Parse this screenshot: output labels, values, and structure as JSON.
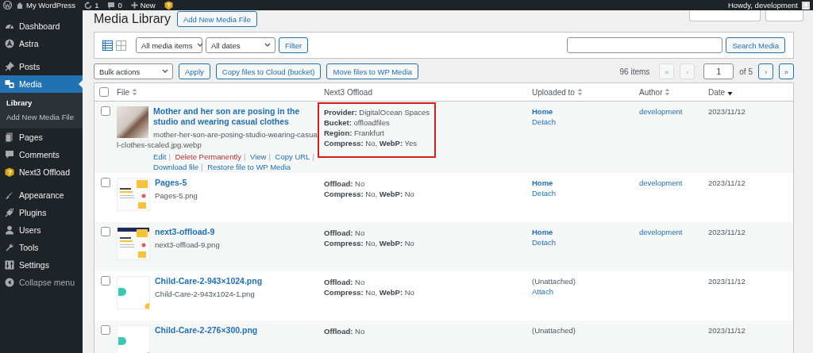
{
  "admin_bar": {
    "site": "My WordPress",
    "updates": "1",
    "comments": "0",
    "new": "New",
    "greeting": "Howdy, development"
  },
  "sidebar": {
    "groups": [
      {
        "items": [
          {
            "label": "Dashboard",
            "selected": false
          },
          {
            "label": "Astra",
            "selected": false
          }
        ]
      },
      {
        "items": [
          {
            "label": "Posts",
            "selected": false
          },
          {
            "label": "Media",
            "selected": true,
            "children": [
              {
                "label": "Library",
                "selected": true
              },
              {
                "label": "Add New Media File",
                "selected": false
              }
            ]
          },
          {
            "label": "Pages",
            "selected": false
          },
          {
            "label": "Comments",
            "selected": false
          },
          {
            "label": "Next3 Offload",
            "selected": false
          }
        ]
      },
      {
        "items": [
          {
            "label": "Appearance",
            "selected": false
          },
          {
            "label": "Plugins",
            "selected": false
          },
          {
            "label": "Users",
            "selected": false
          },
          {
            "label": "Tools",
            "selected": false
          },
          {
            "label": "Settings",
            "selected": false
          },
          {
            "label": "Collapse menu",
            "selected": false
          }
        ]
      }
    ]
  },
  "page": {
    "title": "Media Library",
    "add_button": "Add New Media File"
  },
  "filter_bar": {
    "view_modes": [
      {
        "selected": true
      },
      {
        "selected": false
      }
    ],
    "media_type": "All media items",
    "dates": "All dates",
    "filter_button": "Filter",
    "search_button": "Search Media"
  },
  "tablenav": {
    "bulk_actions": "Bulk actions",
    "apply": "Apply",
    "buttons": [
      "Copy files to Cloud (bucket)",
      "Move files to WP Media"
    ],
    "count": "96 items",
    "pagination": {
      "first": {
        "label": "«",
        "disabled": true
      },
      "prev": {
        "label": "‹",
        "disabled": true
      },
      "current": "1",
      "total": "of 5",
      "next": {
        "label": "›",
        "disabled": false
      },
      "last": {
        "label": "»",
        "disabled": false
      }
    }
  },
  "table": {
    "select_all": {
      "checked": false
    },
    "columns": [
      {
        "label": "File",
        "sortable": true,
        "sorted": false
      },
      {
        "label": "Next3 Offload",
        "sortable": false
      },
      {
        "label": "Uploaded to",
        "sortable": true,
        "sorted": false
      },
      {
        "label": "Author",
        "sortable": true,
        "sorted": false
      },
      {
        "label": "Date",
        "sortable": true,
        "sorted": true
      }
    ],
    "rows": [
      {
        "checked": false,
        "thumbnail": {
          "kind": "photo"
        },
        "title": "Mother and her son are posing in the studio and wearing casual clothes",
        "filename": "mother-her-son-are-posing-studio-wearing-casual-clothes-scaled.jpg.webp",
        "actions": [
          {
            "label": "Edit",
            "kind": "link",
            "separator": "|"
          },
          {
            "label": "Delete Permanently",
            "kind": "delete",
            "separator": "|"
          },
          {
            "label": "View",
            "kind": "link",
            "separator": "|"
          },
          {
            "label": "Copy URL",
            "kind": "link",
            "separator": "|"
          },
          {
            "label": "Download file",
            "kind": "link",
            "separator": "|"
          },
          {
            "label": "Restore file to WP Media",
            "kind": "link"
          }
        ],
        "highlighted": true,
        "offload": [
          "**Provider:** DigitalOcean Spaces",
          "**Bucket:** offloadfiles",
          "**Region:** Frankfurt",
          "**Compress:** No, **WebP:** Yes"
        ],
        "uploaded_to": {
          "kind": "attached",
          "parent": "Home",
          "action": "Detach"
        },
        "author": "development",
        "date": "2023/11/12"
      },
      {
        "checked": false,
        "thumbnail": {
          "kind": "screenshot"
        },
        "title": "Pages-5",
        "filename": "Pages-5.png",
        "highlighted": false,
        "offload": [
          "**Offload:** No",
          "**Compress:** No, **WebP:** No"
        ],
        "uploaded_to": {
          "kind": "attached",
          "parent": "Home",
          "action": "Detach"
        },
        "author": "development",
        "date": "2023/11/12"
      },
      {
        "checked": false,
        "thumbnail": {
          "kind": "darkscreenshot"
        },
        "title": "next3-offload-9",
        "filename": "next3-offload-9.png",
        "highlighted": false,
        "offload": [
          "**Offload:** No",
          "**Compress:** No, **WebP:** No"
        ],
        "uploaded_to": {
          "kind": "attached",
          "parent": "Home",
          "action": "Detach"
        },
        "author": "development",
        "date": "2023/11/12"
      },
      {
        "checked": false,
        "thumbnail": {
          "kind": "graphic"
        },
        "title": "Child-Care-2-943×1024.png",
        "filename": "Child-Care-2-943x1024-1.png",
        "highlighted": false,
        "offload": [
          "**Offload:** No",
          "**Compress:** No, **WebP:** No"
        ],
        "uploaded_to": {
          "kind": "unattached",
          "parent": "(Unattached)",
          "action": "Attach"
        },
        "date": "2023/11/12"
      },
      {
        "checked": false,
        "thumbnail": {
          "kind": "graphic"
        },
        "title": "Child-Care-2-276×300.png",
        "highlighted": false,
        "offload": [
          "**Offload:** No"
        ],
        "uploaded_to": {
          "kind": "unattached",
          "parent": "(Unattached)"
        },
        "date": "2023/11/12"
      }
    ]
  }
}
